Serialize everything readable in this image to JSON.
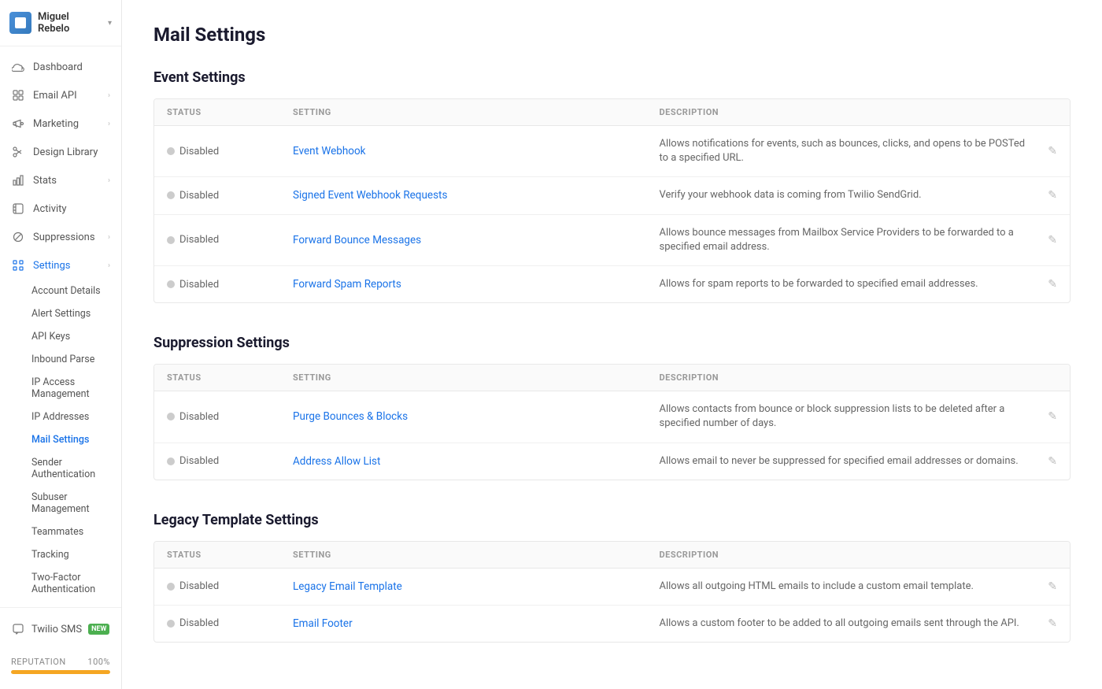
{
  "brand": {
    "name": "Miguel Rebelo",
    "chevron": "▾"
  },
  "sidebar": {
    "nav_items": [
      {
        "id": "dashboard",
        "label": "Dashboard",
        "icon": "cloud",
        "expandable": false
      },
      {
        "id": "email-api",
        "label": "Email API",
        "icon": "grid",
        "expandable": true
      },
      {
        "id": "marketing",
        "label": "Marketing",
        "icon": "megaphone",
        "expandable": true
      },
      {
        "id": "design-library",
        "label": "Design Library",
        "icon": "scissors",
        "expandable": false
      },
      {
        "id": "stats",
        "label": "Stats",
        "icon": "bar-chart",
        "expandable": true
      },
      {
        "id": "activity",
        "label": "Activity",
        "icon": "calendar",
        "expandable": false
      },
      {
        "id": "suppressions",
        "label": "Suppressions",
        "icon": "prohibit",
        "expandable": true
      },
      {
        "id": "settings",
        "label": "Settings",
        "icon": "settings-grid",
        "expandable": true,
        "active": true
      }
    ],
    "settings_sub_items": [
      {
        "id": "account-details",
        "label": "Account Details"
      },
      {
        "id": "alert-settings",
        "label": "Alert Settings"
      },
      {
        "id": "api-keys",
        "label": "API Keys"
      },
      {
        "id": "inbound-parse",
        "label": "Inbound Parse"
      },
      {
        "id": "ip-access-management",
        "label": "IP Access Management"
      },
      {
        "id": "ip-addresses",
        "label": "IP Addresses"
      },
      {
        "id": "mail-settings",
        "label": "Mail Settings",
        "active": true
      },
      {
        "id": "sender-authentication",
        "label": "Sender Authentication"
      },
      {
        "id": "subuser-management",
        "label": "Subuser Management"
      },
      {
        "id": "teammates",
        "label": "Teammates"
      },
      {
        "id": "tracking",
        "label": "Tracking"
      },
      {
        "id": "two-factor-authentication",
        "label": "Two-Factor Authentication"
      }
    ],
    "twilio_sms_label": "Twilio SMS",
    "new_badge_label": "NEW"
  },
  "reputation": {
    "label": "REPUTATION",
    "value": "100%",
    "fill_percent": 100
  },
  "page": {
    "title": "Mail Settings"
  },
  "event_settings": {
    "section_title": "Event Settings",
    "columns": {
      "status": "STATUS",
      "setting": "SETTING",
      "description": "DESCRIPTION"
    },
    "rows": [
      {
        "status": "Disabled",
        "setting": "Event Webhook",
        "description": "Allows notifications for events, such as bounces, clicks, and opens to be POSTed to a specified URL."
      },
      {
        "status": "Disabled",
        "setting": "Signed Event Webhook Requests",
        "description": "Verify your webhook data is coming from Twilio SendGrid."
      },
      {
        "status": "Disabled",
        "setting": "Forward Bounce Messages",
        "description": "Allows bounce messages from Mailbox Service Providers to be forwarded to a specified email address."
      },
      {
        "status": "Disabled",
        "setting": "Forward Spam Reports",
        "description": "Allows for spam reports to be forwarded to specified email addresses."
      }
    ]
  },
  "suppression_settings": {
    "section_title": "Suppression Settings",
    "columns": {
      "status": "STATUS",
      "setting": "SETTING",
      "description": "DESCRIPTION"
    },
    "rows": [
      {
        "status": "Disabled",
        "setting": "Purge Bounces & Blocks",
        "description": "Allows contacts from bounce or block suppression lists to be deleted after a specified number of days."
      },
      {
        "status": "Disabled",
        "setting": "Address Allow List",
        "description": "Allows email to never be suppressed for specified email addresses or domains."
      }
    ]
  },
  "legacy_template_settings": {
    "section_title": "Legacy Template Settings",
    "columns": {
      "status": "STATUS",
      "setting": "SETTING",
      "description": "DESCRIPTION"
    },
    "rows": [
      {
        "status": "Disabled",
        "setting": "Legacy Email Template",
        "description": "Allows all outgoing HTML emails to include a custom email template."
      },
      {
        "status": "Disabled",
        "setting": "Email Footer",
        "description": "Allows a custom footer to be added to all outgoing emails sent through the API."
      }
    ]
  }
}
